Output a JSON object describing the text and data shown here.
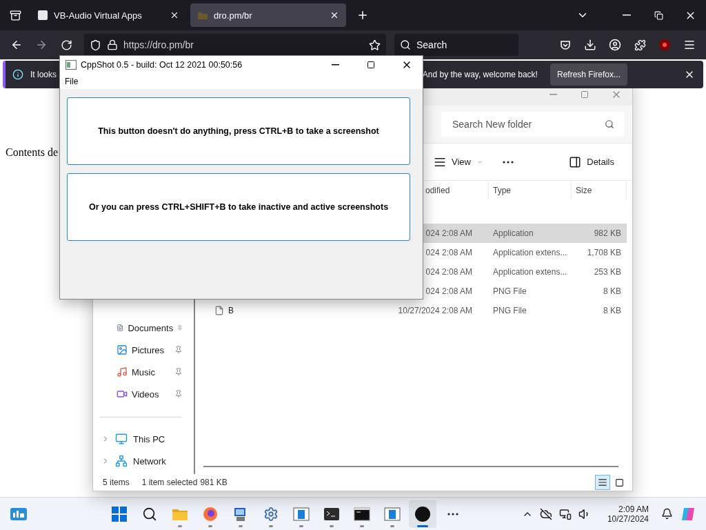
{
  "browser": {
    "tabs": [
      {
        "title": "VB-Audio Virtual Apps",
        "kind": "vb",
        "selected": false
      },
      {
        "title": "dro.pm/br",
        "kind": "site",
        "selected": true
      }
    ],
    "address": "https://dro.pm/br",
    "search_placeholder": "Search",
    "notification": {
      "text_start": "It looks",
      "text_end": "And by the way, welcome back!",
      "button": "Refresh Firefox..."
    },
    "page_text": "Contents de"
  },
  "explorer": {
    "search_placeholder": "Search New folder",
    "view_label": "View",
    "details_label": "Details",
    "columns": [
      "odified",
      "Type",
      "Size"
    ],
    "rows": [
      {
        "date": "024 2:08 AM",
        "type": "Application",
        "size": "982 KB",
        "selected": true
      },
      {
        "date": "024 2:08 AM",
        "type": "Application extens...",
        "size": "1,708 KB",
        "selected": false
      },
      {
        "date": "024 2:08 AM",
        "type": "Application extens...",
        "size": "253 KB",
        "selected": false
      },
      {
        "date": "024 2:08 AM",
        "type": "PNG File",
        "size": "8 KB",
        "selected": false
      },
      {
        "name": "B",
        "date": "10/27/2024 2:08 AM",
        "type": "PNG File",
        "size": "8 KB",
        "selected": false
      }
    ],
    "quick_access": [
      {
        "label": "Documents",
        "kind": "documents",
        "pinned": true
      },
      {
        "label": "Pictures",
        "kind": "pictures",
        "pinned": true
      },
      {
        "label": "Music",
        "kind": "music",
        "pinned": true
      },
      {
        "label": "Videos",
        "kind": "videos",
        "pinned": true
      }
    ],
    "tree": [
      {
        "label": "This PC",
        "kind": "pc",
        "expanded": false
      },
      {
        "label": "Network",
        "kind": "network",
        "expanded": false
      }
    ],
    "status": {
      "count": "5 items",
      "selection": "1 item selected",
      "size": "981 KB"
    },
    "view_buttons": [
      {
        "kind": "details",
        "selected": true
      },
      {
        "kind": "tiles",
        "selected": false
      }
    ]
  },
  "cppshot": {
    "title": "CppShot 0.5 - build: Oct 12 2021 00:50:56",
    "menu": [
      "File"
    ],
    "buttons": [
      "This button doesn't do anything, press CTRL+B to take a screenshot",
      "Or you can press CTRL+SHIFT+B to take inactive and active screenshots"
    ]
  },
  "taskbar": {
    "apps": [
      {
        "kind": "start",
        "selected": false
      },
      {
        "kind": "search",
        "selected": false
      },
      {
        "kind": "folder",
        "running": true,
        "selected": false
      },
      {
        "kind": "browser",
        "running": true,
        "selected": false
      },
      {
        "kind": "computer",
        "running": true,
        "selected": false
      },
      {
        "kind": "settings",
        "running": true,
        "selected": false
      },
      {
        "kind": "window",
        "running": true,
        "selected": false
      },
      {
        "kind": "terminal",
        "running": true,
        "selected": false
      },
      {
        "kind": "console",
        "running": true,
        "selected": false
      },
      {
        "kind": "window",
        "running": true,
        "selected": false
      },
      {
        "kind": "round",
        "running": true,
        "selected": true
      },
      {
        "kind": "more",
        "selected": false
      }
    ],
    "time": "2:09 AM",
    "date": "10/27/2024"
  }
}
